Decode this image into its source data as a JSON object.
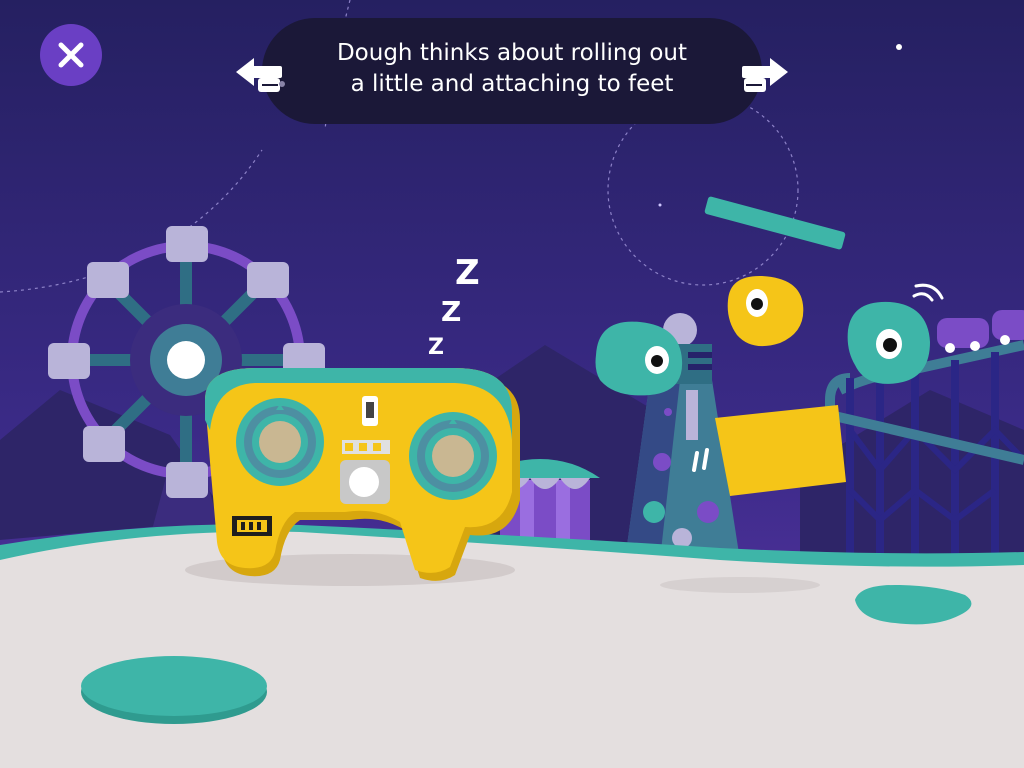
{
  "caption": {
    "line1": "Dough thinks about rolling out",
    "line2": "a little and attaching to feet"
  },
  "scene": {
    "sleep_letters": [
      "Z",
      "Z",
      "Z"
    ],
    "controller_color": "#f5c518",
    "accent_teal": "#3eb5a8",
    "sky_color": "#2a2263",
    "ground_color": "#e4dfdf"
  },
  "icons": {
    "close": "close-icon",
    "previous": "pointing-hand-left-icon",
    "next": "pointing-hand-right-icon"
  }
}
